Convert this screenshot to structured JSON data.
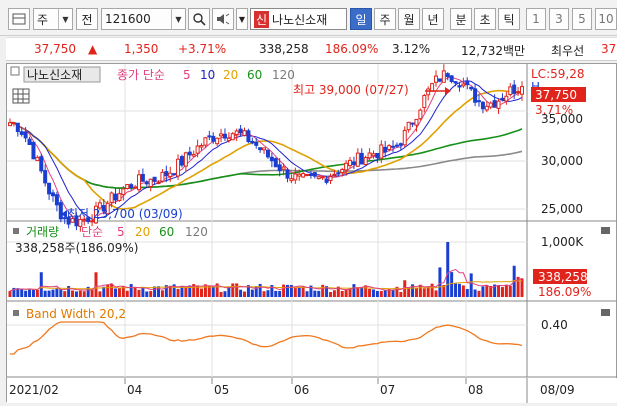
{
  "toolbar": {
    "market_label": "주",
    "prev_label": "전",
    "code_value": "121600",
    "mode_label": "신",
    "stock_name": "나노신소재",
    "periods": [
      "일",
      "주",
      "월",
      "년",
      "분",
      "초",
      "틱"
    ],
    "active_period": "일",
    "intervals": [
      "1",
      "3",
      "5",
      "10"
    ]
  },
  "quote": {
    "price": "37,750",
    "change_arrow": "▲",
    "change": "1,350",
    "change_pct": "+3.71%",
    "volume": "338,258",
    "volume_ratio": "186.09%",
    "turnover_pct": "3.12%",
    "trade_value": "12,732백만",
    "priority_label": "최우선",
    "priority_value": "37"
  },
  "price_panel": {
    "stock_tag": "나노신소재",
    "ma_label": "종가 단순",
    "ma_periods": [
      "5",
      "10",
      "20",
      "60",
      "120"
    ],
    "ma_colors": [
      "#e04080",
      "#2020d0",
      "#e0a000",
      "#189018",
      "#7a7a7a"
    ],
    "lc_label": "LC:59,28",
    "h_label": "H",
    "price_box": "37,750",
    "pct_box": "3.71%",
    "y_ticks": [
      "35,000",
      "30,000",
      "25,000"
    ],
    "high_note": "최고 39,000 (07/27)",
    "low_note": "최저 23,700 (03/09)"
  },
  "volume_panel": {
    "title": "거래량",
    "ma_label": "단순",
    "ma_periods": [
      "5",
      "20",
      "60",
      "120"
    ],
    "sub_label": "338,258주(186.09%)",
    "y_tick": "1,000K",
    "vol_box": "338,258",
    "pct_box": "186.09%"
  },
  "band_panel": {
    "title": "Band Width 20,2",
    "y_tick": "0.40"
  },
  "x_axis": {
    "labels": [
      "2021/02",
      "04",
      "05",
      "06",
      "07",
      "08",
      "08/09"
    ]
  },
  "chart_data": {
    "type": "candlestick",
    "x_range": [
      "2021/02",
      "2021/08/09"
    ],
    "y_range": [
      23700,
      39000
    ],
    "close_anchors": [
      {
        "date": "2021/02",
        "close": 34000
      },
      {
        "date": "2021/03/09",
        "close": 23700
      },
      {
        "date": "2021/04",
        "close": 28000
      },
      {
        "date": "2021/05",
        "close": 33000
      },
      {
        "date": "2021/06",
        "close": 28000
      },
      {
        "date": "2021/07",
        "close": 31000
      },
      {
        "date": "2021/07/27",
        "close": 39000
      },
      {
        "date": "2021/08",
        "close": 36000
      },
      {
        "date": "2021/08/09",
        "close": 37750
      }
    ],
    "current": {
      "price": 37750,
      "change": 1350,
      "change_pct": 3.71,
      "volume": 338258
    }
  }
}
